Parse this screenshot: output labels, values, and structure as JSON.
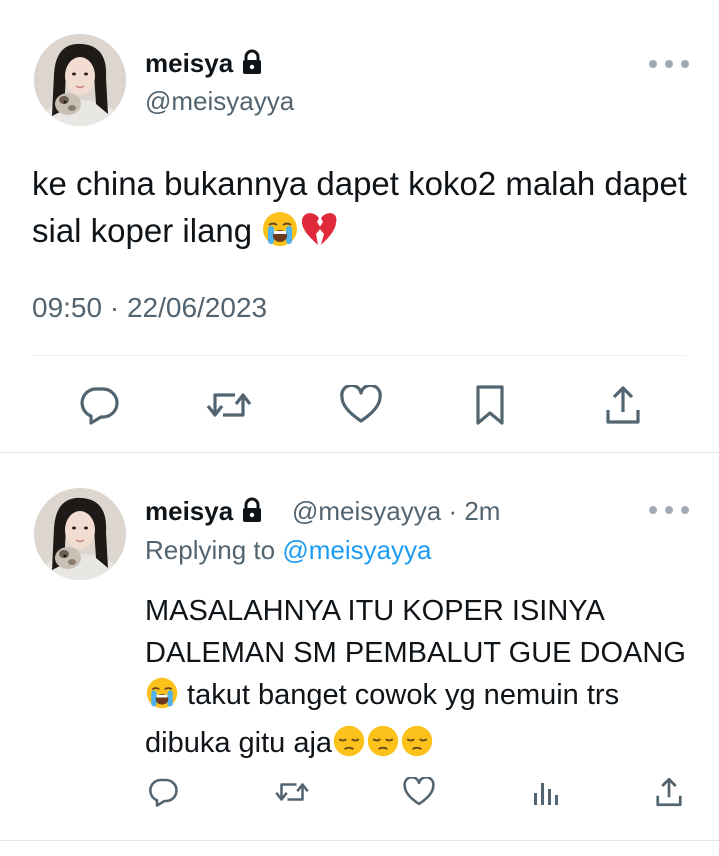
{
  "main_tweet": {
    "display_name": "meisya",
    "handle": "@meisyayya",
    "text": "ke china bukannya dapet koko2 malah dapet sial koper ilang",
    "emojis": [
      "loudly-crying-face",
      "broken-heart"
    ],
    "timestamp": "09:50 · 22/06/2023",
    "actions": [
      "reply-icon",
      "retweet-icon",
      "like-icon",
      "bookmark-icon",
      "share-icon"
    ]
  },
  "reply_tweet": {
    "display_name": "meisya",
    "handle": "@meisyayya",
    "time_ago": "· 2m",
    "replying_to_label": "Replying to",
    "replying_to_handle": "@meisyayya",
    "text_part1": "MASALAHNYA ITU KOPER ISINYA DALEMAN SM PEMBALUT GUE DOANG",
    "text_part2": " takut banget cowok yg nemuin trs dibuka gitu aja",
    "emojis": [
      "loudly-crying-face",
      "pensive-face",
      "pensive-face",
      "pensive-face"
    ],
    "actions": [
      "reply-icon",
      "retweet-icon",
      "like-icon",
      "views-icon",
      "share-icon"
    ]
  },
  "colors": {
    "text": "#0f1419",
    "secondary": "#536471",
    "link": "#1d9bf0",
    "icon": "#536471",
    "divider": "#eff3f4"
  }
}
